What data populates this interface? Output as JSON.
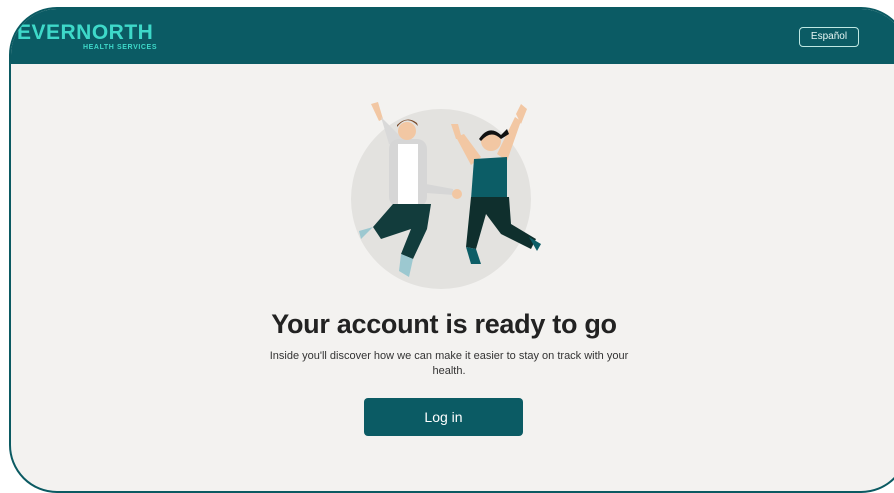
{
  "header": {
    "logo_text": "EVERNORTH",
    "logo_subtext": "HEALTH SERVICES",
    "language_button": "Español"
  },
  "main": {
    "title": "Your account is ready to go",
    "subtitle": "Inside you'll discover how we can make it easier to stay on track with your health.",
    "login_button": "Log in"
  },
  "colors": {
    "brand_teal": "#0b5b64",
    "logo_green": "#3ed9c9",
    "background": "#f3f2f0"
  },
  "illustration": {
    "icon": "two-people-jumping-illustration"
  }
}
